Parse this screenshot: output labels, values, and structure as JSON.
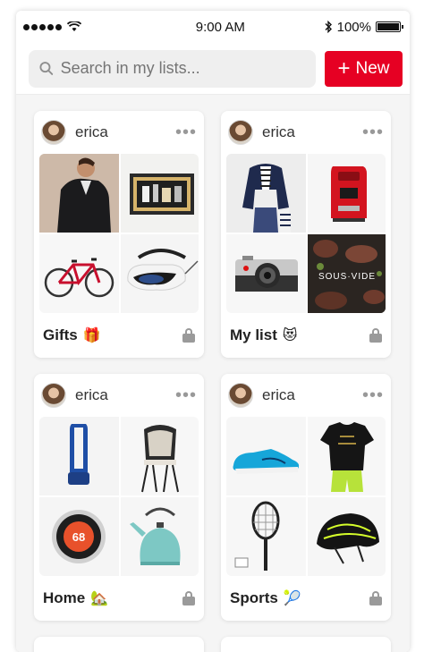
{
  "status_bar": {
    "time": "9:00 AM",
    "battery": "100%"
  },
  "toolbar": {
    "search_placeholder": "Search in my lists...",
    "new_label": "New",
    "new_icon": "plus-icon"
  },
  "colors": {
    "accent": "#e60023",
    "search_bg": "#efefef",
    "feed_bg": "#f5f5f5"
  },
  "cards": [
    {
      "user": "erica",
      "name": "Gifts",
      "emoji": "🎁",
      "images": [
        "man-in-leather-jacket",
        "boxed-gift-set",
        "red-road-bicycle",
        "vr-headset"
      ]
    },
    {
      "user": "erica",
      "name": "My list",
      "emoji": "😻",
      "images": [
        "navy-blazer-outfit",
        "red-espresso-machine",
        "silver-camera",
        "sous-vide-cookbook"
      ]
    },
    {
      "user": "erica",
      "name": "Home",
      "emoji": "🏡",
      "images": [
        "blue-tower-fan",
        "chair-with-fur-throw",
        "smart-thermostat",
        "teal-tea-kettle"
      ]
    },
    {
      "user": "erica",
      "name": "Sports",
      "emoji": "🎾",
      "images": [
        "blue-running-shoe",
        "black-tshirt-and-shorts",
        "tennis-racket",
        "cycling-helmet"
      ]
    }
  ],
  "thermostat_reading": "68",
  "cookbook_title": "SOUS·VIDE"
}
